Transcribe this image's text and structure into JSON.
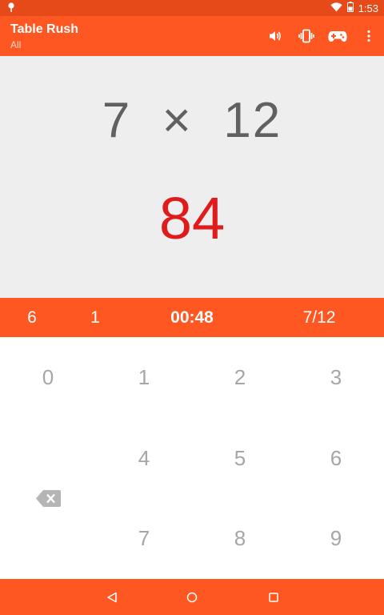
{
  "status_bar": {
    "time": "1:53",
    "notification_icon": "pin-icon",
    "wifi_icon": "wifi-icon",
    "battery_icon": "battery-icon"
  },
  "app_bar": {
    "title": "Table Rush",
    "subtitle": "All",
    "actions": [
      "volume-icon",
      "vibrate-icon",
      "gamepad-icon",
      "overflow-menu-icon"
    ]
  },
  "question": {
    "left_operand": "7",
    "operator": "×",
    "right_operand": "12",
    "answer": "84"
  },
  "stats": {
    "stat_1": "6",
    "stat_2": "1",
    "timer": "00:48",
    "progress": "7/12"
  },
  "keypad": {
    "keys": [
      "0",
      "1",
      "2",
      "3",
      "4",
      "5",
      "6",
      "7",
      "8",
      "9"
    ],
    "backspace_icon": "backspace-icon"
  },
  "nav_bar": {
    "buttons": [
      "back-icon",
      "home-icon",
      "recents-icon"
    ]
  },
  "colors": {
    "primary": "#ff5722",
    "primary_dark": "#e64a19",
    "question_background": "#eeeeee",
    "answer_text": "#e01b1b",
    "question_text": "#616161",
    "key_text": "#a6a6a6"
  }
}
